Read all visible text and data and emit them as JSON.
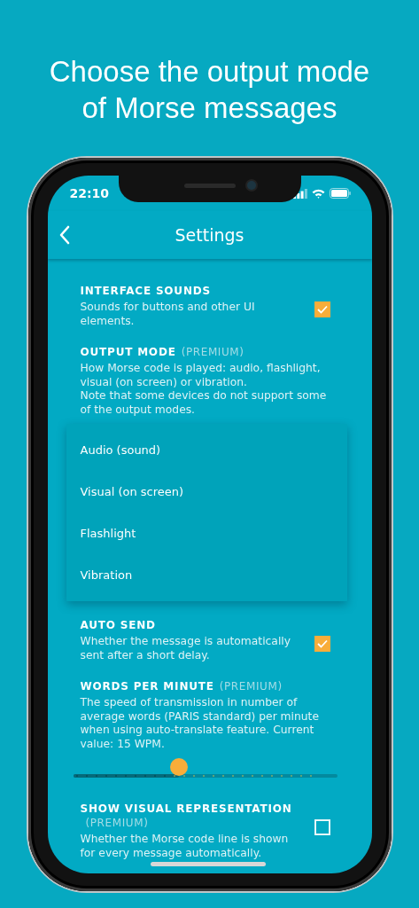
{
  "headline": "Choose the output mode of Morse messages",
  "status_bar": {
    "time": "22:10"
  },
  "nav": {
    "title": "Settings"
  },
  "settings": [
    {
      "kind": "checkbox",
      "title": "INTERFACE SOUNDS",
      "description": "Sounds for buttons and other UI elements.",
      "checked": true
    },
    {
      "kind": "select",
      "title": "OUTPUT MODE",
      "badge": "(PREMIUM)",
      "description": "How Morse code is played: audio, flashlight, visual (on screen) or vibration.\nNote that some devices do not support some of the output modes.",
      "expanded": true,
      "options": [
        {
          "label": "Audio (sound)",
          "selected": false
        },
        {
          "label": "Visual (on screen)",
          "selected": false
        },
        {
          "label": "Flashlight",
          "selected": false
        },
        {
          "label": "Vibration",
          "selected": false
        }
      ]
    },
    {
      "kind": "checkbox",
      "title": "AUTO SEND",
      "description": "Whether the message is automatically sent after a short delay.",
      "checked": true
    },
    {
      "kind": "slider",
      "title": "WORDS PER MINUTE",
      "badge": "(PREMIUM)",
      "description": "The speed of transmission in number of average words (PARIS standard) per minute when using auto-translate feature. Current value: 15 WPM.",
      "level": 0.4
    },
    {
      "kind": "checkbox",
      "title": "SHOW VISUAL REPRESENTATION",
      "badge": "(PREMIUM)",
      "description": "Whether the Morse code line is shown for every message automatically.",
      "checked": false
    }
  ]
}
